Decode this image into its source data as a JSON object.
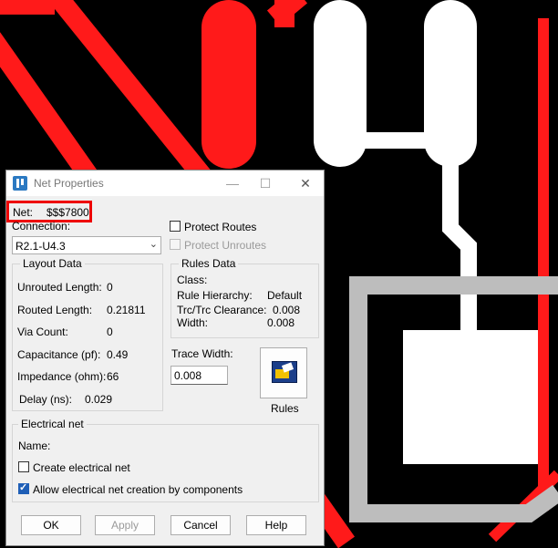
{
  "window": {
    "title": "Net Properties",
    "minimize": "—",
    "maximize": "☐",
    "close": "✕"
  },
  "net": {
    "label": "Net:",
    "value": "$$$7800"
  },
  "connection": {
    "label": "Connection:",
    "value": "R2.1-U4.3"
  },
  "protect_routes": {
    "label": "Protect Routes",
    "checked": false
  },
  "protect_unroutes": {
    "label": "Protect Unroutes",
    "checked": false,
    "disabled": true
  },
  "layout": {
    "title": "Layout Data",
    "rows": [
      {
        "label": "Unrouted Length:",
        "value": "0"
      },
      {
        "label": "Routed Length:",
        "value": "0.21811"
      },
      {
        "label": "Via Count:",
        "value": "0"
      },
      {
        "label": "Capacitance (pf):",
        "value": "0.49"
      },
      {
        "label": "Impedance (ohm):",
        "value": "66"
      },
      {
        "label": "Delay (ns):",
        "value": "0.029"
      }
    ]
  },
  "rules_data": {
    "title": "Rules Data",
    "class_label": "Class:",
    "class_value": "",
    "hierarchy_label": "Rule Hierarchy:",
    "hierarchy_value": "Default",
    "clearance_label": "Trc/Trc Clearance:",
    "clearance_value": "0.008",
    "width_label": "Width:",
    "width_value": "0.008"
  },
  "trace_width": {
    "label": "Trace Width:",
    "value": "0.008"
  },
  "rules_button": {
    "label": "Rules",
    "icon": "rules-icon"
  },
  "electrical": {
    "title": "Electrical net",
    "name_label": "Name:",
    "create_label": "Create electrical net",
    "create_checked": false,
    "allow_label": "Allow electrical net creation by components",
    "allow_checked": true
  },
  "buttons": {
    "ok": "OK",
    "apply": "Apply",
    "cancel": "Cancel",
    "help": "Help"
  },
  "colors": {
    "trace_red": "#ff1a1a",
    "pad_white": "#ffffff",
    "outline_gray": "#bdbdbd",
    "highlight_red": "#e00000"
  }
}
